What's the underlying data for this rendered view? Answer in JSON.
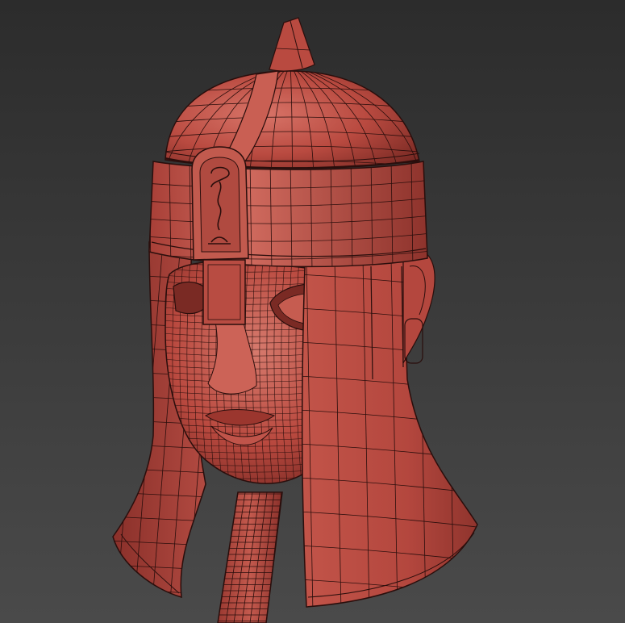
{
  "scene": {
    "subject": "helmet-with-face-mask-wireframe",
    "colors": {
      "background_top": "#2c2c2c",
      "background_bottom": "#4a4a4a",
      "mesh_base": "#b8463d",
      "mesh_light": "#d4685d",
      "mesh_dark": "#6e2520",
      "wire": "#2a0e0c"
    }
  }
}
